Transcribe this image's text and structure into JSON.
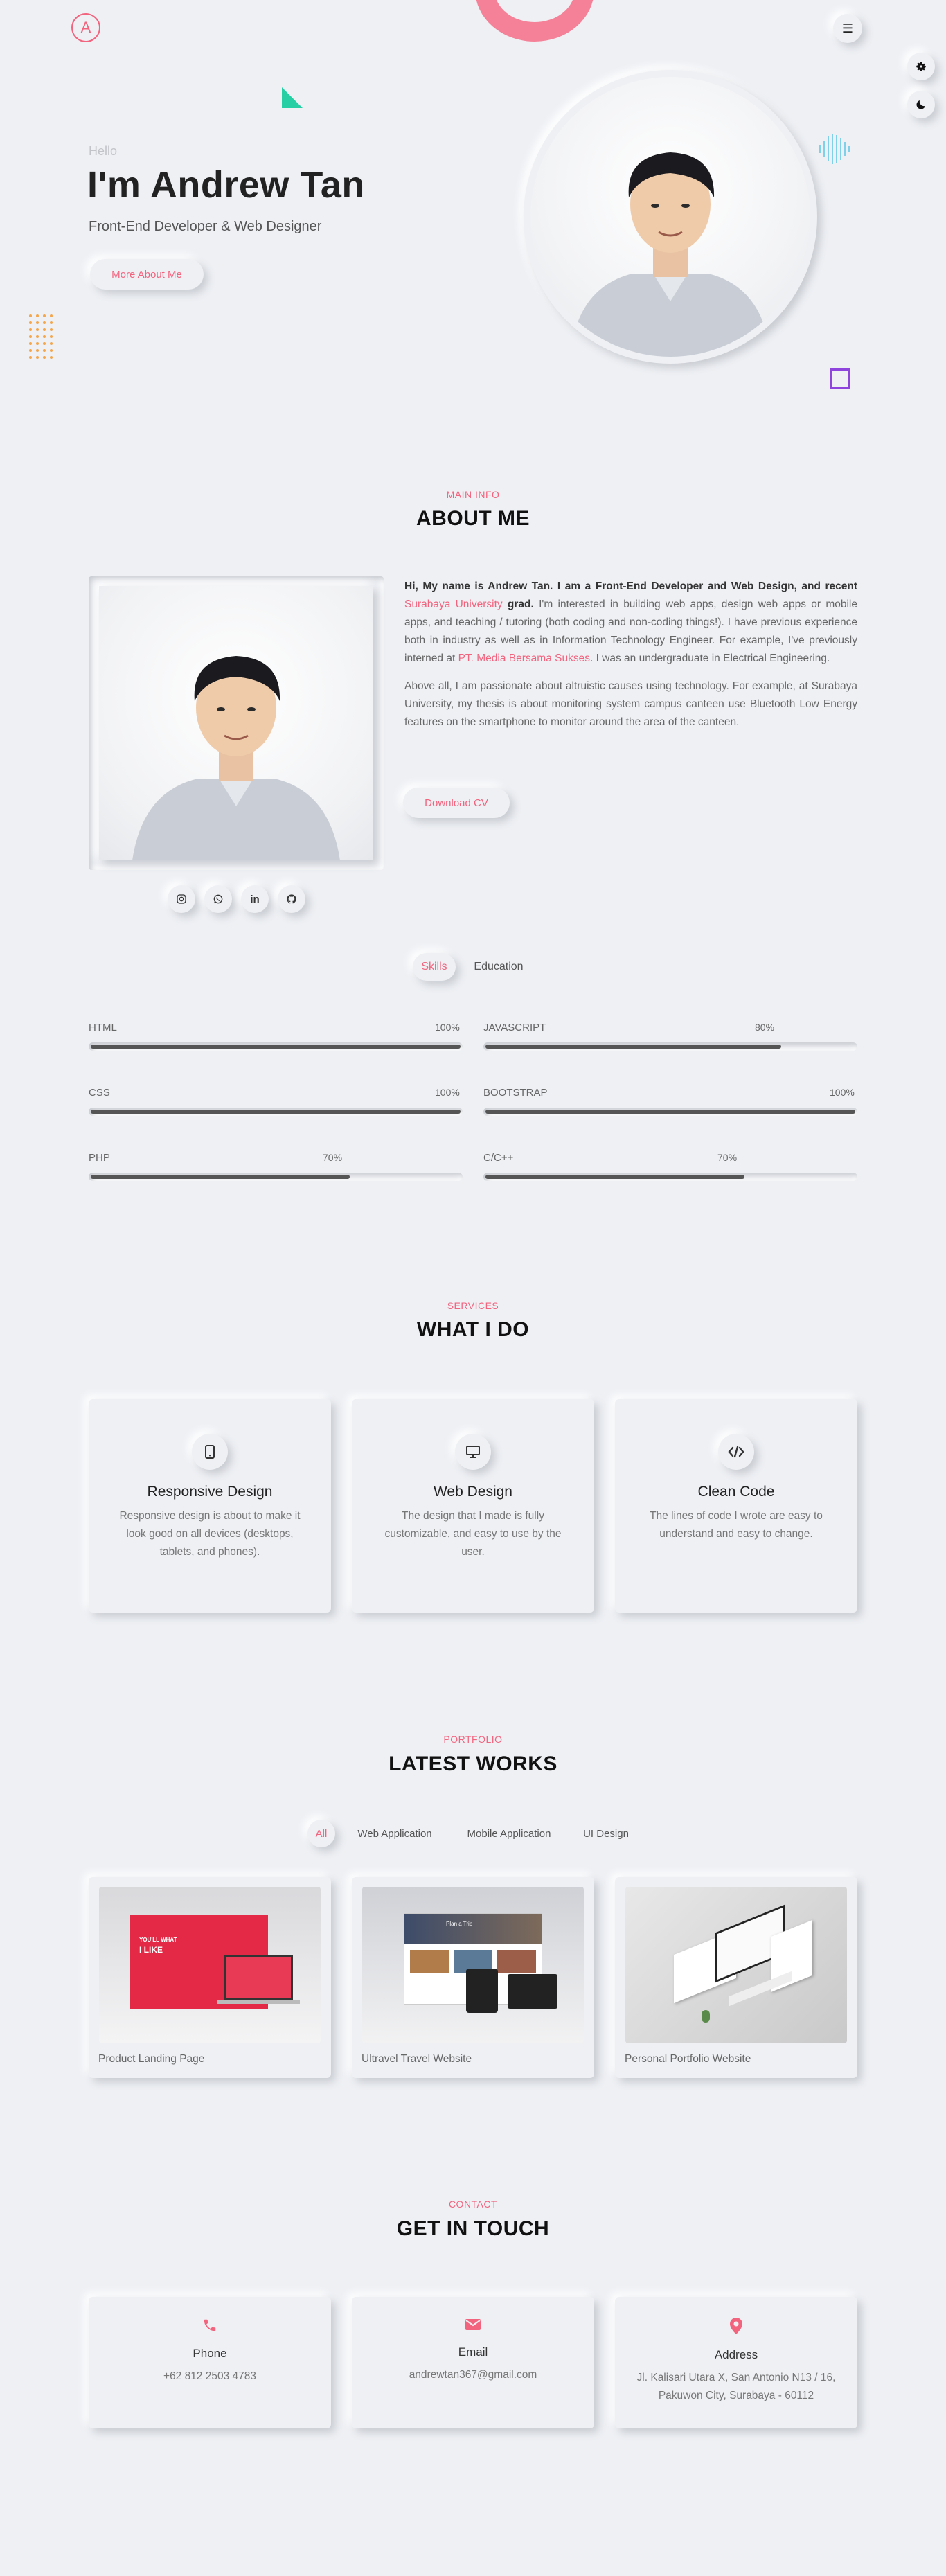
{
  "colors": {
    "accent": "#f2637e",
    "background": "#eef0f4",
    "square": "#8e44dd",
    "triangle": "#26d0a4"
  },
  "header": {
    "logo": "A",
    "menu_icon": "hamburger-icon"
  },
  "side_buttons": [
    {
      "icon": "gear-icon"
    },
    {
      "icon": "moon-icon"
    }
  ],
  "hero": {
    "greeting": "Hello",
    "name": "I'm Andrew Tan",
    "role": "Front-End Developer & Web Designer",
    "button": "More About Me"
  },
  "about": {
    "subtitle": "MAIN INFO",
    "title": "ABOUT ME",
    "p1_intro": "Hi, My name is Andrew Tan. I am a Front-End Developer and Web Design, and recent",
    "p1_university": "Surabaya University",
    "p1_grad": "grad.",
    "p1_body": " I'm interested in building web apps, design web apps or mobile apps, and teaching / tutoring (both coding and non-coding things!). I have previous experience both in industry as well as in Information Technology Engineer. For example, I've previously interned at ",
    "p1_company": "PT. Media Bersama Sukses",
    "p1_end": ". I was an undergraduate in Electrical Engineering.",
    "p2": "Above all, I am passionate about altruistic causes using technology. For example, at Surabaya University, my thesis is about monitoring system campus canteen use Bluetooth Low Energy features on the smartphone to monitor around the area of the canteen.",
    "cv_button": "Download CV",
    "socials": [
      "instagram-icon",
      "whatsapp-icon",
      "linkedin-icon",
      "github-icon"
    ]
  },
  "skill_tabs": [
    "Skills",
    "Education"
  ],
  "skills": [
    {
      "name": "HTML",
      "label": "100%",
      "value": 100
    },
    {
      "name": "JAVASCRIPT",
      "label": "80%",
      "value": 80
    },
    {
      "name": "CSS",
      "label": "100%",
      "value": 100
    },
    {
      "name": "BOOTSTRAP",
      "label": "100%",
      "value": 100
    },
    {
      "name": "PHP",
      "label": "70%",
      "value": 70
    },
    {
      "name": "C/C++",
      "label": "70%",
      "value": 70
    }
  ],
  "services": {
    "subtitle": "SERVICES",
    "title": "WHAT I DO",
    "items": [
      {
        "icon": "mobile-icon",
        "title": "Responsive Design",
        "desc": "Responsive design is about to make it look good on all devices (desktops, tablets, and phones)."
      },
      {
        "icon": "monitor-icon",
        "title": "Web Design",
        "desc": "The design that I made is fully customizable, and easy to use by the user."
      },
      {
        "icon": "code-icon",
        "title": "Clean Code",
        "desc": "The lines of code I wrote are easy to understand and easy to change."
      }
    ]
  },
  "portfolio": {
    "subtitle": "PORTFOLIO",
    "title": "LATEST WORKS",
    "filters": [
      "All",
      "Web Application",
      "Mobile Application",
      "UI Design"
    ],
    "items": [
      {
        "title": "Product Landing Page",
        "mock_heading": "YOU'LL WHAT",
        "mock_sub": "I LIKE"
      },
      {
        "title": "Ultravel Travel Website",
        "mock_heading": "Plan a Trip"
      },
      {
        "title": "Personal Portfolio Website"
      }
    ]
  },
  "contact": {
    "subtitle": "CONTACT",
    "title": "GET IN TOUCH",
    "items": [
      {
        "icon": "phone-icon",
        "title": "Phone",
        "value": "+62 812 2503 4783"
      },
      {
        "icon": "envelope-icon",
        "title": "Email",
        "value": "andrewtan367@gmail.com"
      },
      {
        "icon": "map-pin-icon",
        "title": "Address",
        "value": "Jl. Kalisari Utara X, San Antonio N13 / 16, Pakuwon City, Surabaya - 60112"
      }
    ]
  }
}
